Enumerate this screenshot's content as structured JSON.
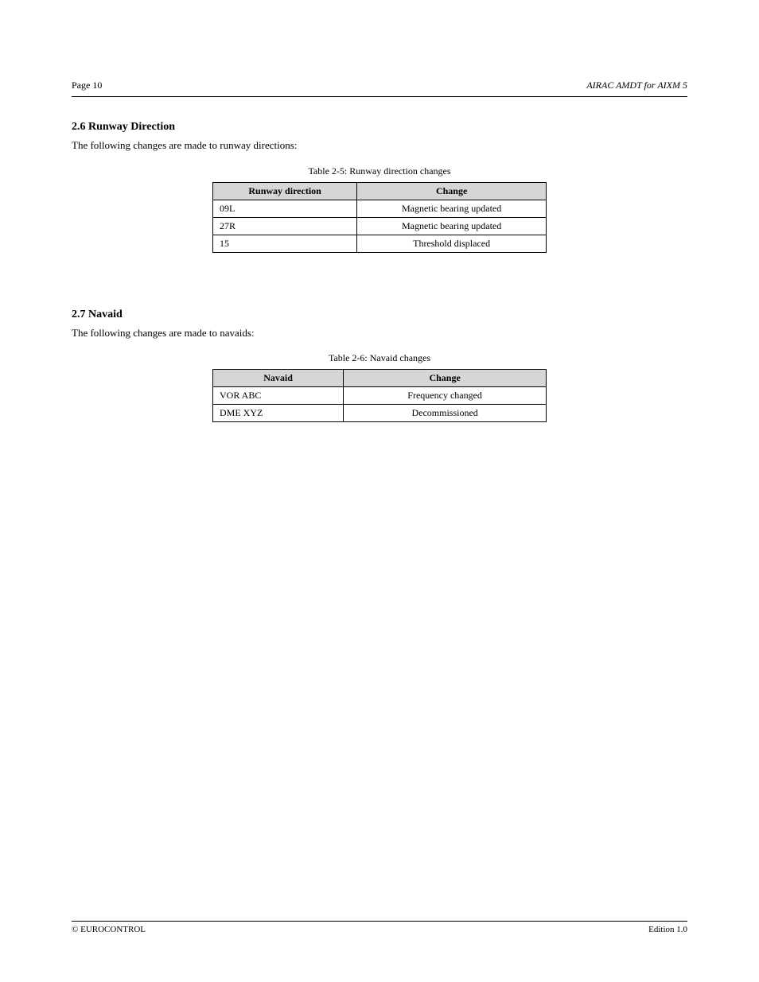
{
  "header": {
    "left": "Page 10",
    "right": "AIRAC AMDT for AIXM 5"
  },
  "section1": {
    "title": "2.6 Runway Direction",
    "intro": "The following changes are made to runway directions:",
    "tableCaption": "Table 2-5: Runway direction changes",
    "headers": [
      "Runway direction",
      "Change"
    ],
    "rows": [
      [
        "09L",
        "Magnetic bearing updated"
      ],
      [
        "27R",
        "Magnetic bearing updated"
      ],
      [
        "15",
        "Threshold displaced"
      ]
    ]
  },
  "section2": {
    "title": "2.7 Navaid",
    "intro": "The following changes are made to navaids:",
    "tableCaption": "Table 2-6: Navaid changes",
    "headers": [
      "Navaid",
      "Change"
    ],
    "rows": [
      [
        "VOR ABC",
        "Frequency changed"
      ],
      [
        "DME XYZ",
        "Decommissioned"
      ]
    ]
  },
  "footer": {
    "left": "© EUROCONTROL",
    "right": "Edition 1.0"
  }
}
